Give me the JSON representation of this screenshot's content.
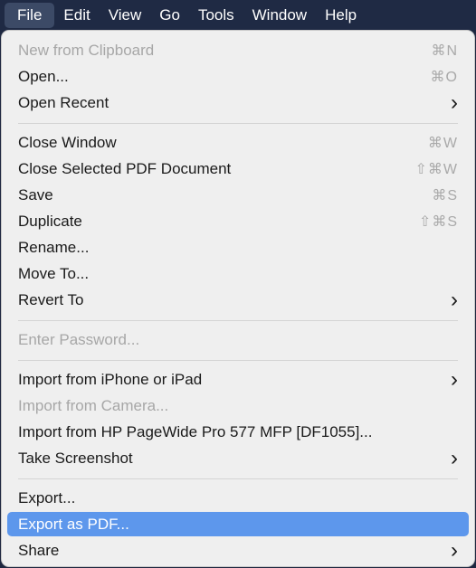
{
  "menubar": {
    "items": [
      {
        "label": "File",
        "active": true
      },
      {
        "label": "Edit"
      },
      {
        "label": "View"
      },
      {
        "label": "Go"
      },
      {
        "label": "Tools"
      },
      {
        "label": "Window"
      },
      {
        "label": "Help"
      }
    ]
  },
  "file_menu": {
    "groups": [
      [
        {
          "label": "New from Clipboard",
          "shortcut": "⌘N",
          "disabled": true
        },
        {
          "label": "Open...",
          "shortcut": "⌘O"
        },
        {
          "label": "Open Recent",
          "submenu": true
        }
      ],
      [
        {
          "label": "Close Window",
          "shortcut": "⌘W"
        },
        {
          "label": "Close Selected PDF Document",
          "shortcut": "⇧⌘W"
        },
        {
          "label": "Save",
          "shortcut": "⌘S"
        },
        {
          "label": "Duplicate",
          "shortcut": "⇧⌘S"
        },
        {
          "label": "Rename..."
        },
        {
          "label": "Move To..."
        },
        {
          "label": "Revert To",
          "submenu": true
        }
      ],
      [
        {
          "label": "Enter Password...",
          "disabled": true
        }
      ],
      [
        {
          "label": "Import from iPhone or iPad",
          "submenu": true
        },
        {
          "label": "Import from Camera...",
          "disabled": true
        },
        {
          "label": "Import from HP PageWide Pro 577 MFP [DF1055]..."
        },
        {
          "label": "Take Screenshot",
          "submenu": true
        }
      ],
      [
        {
          "label": "Export..."
        },
        {
          "label": "Export as PDF...",
          "selected": true
        },
        {
          "label": "Share",
          "submenu": true
        }
      ]
    ]
  },
  "icons": {
    "submenu": "chevron-right-icon"
  },
  "colors": {
    "selection": "#5d97ec",
    "menubar": "#1f2a44"
  }
}
